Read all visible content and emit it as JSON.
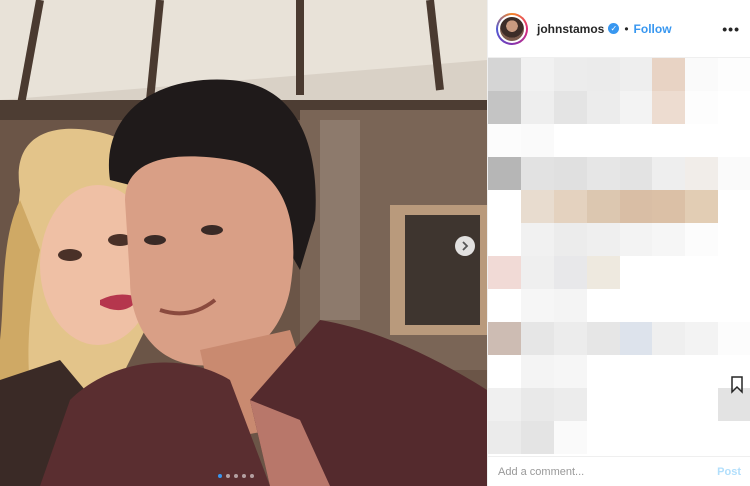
{
  "header": {
    "username": "johnstamos",
    "verified_glyph": "✓",
    "separator": "•",
    "follow_label": "Follow",
    "more_label": "•••"
  },
  "post": {
    "carousel_next_icon": "chevron-right-icon",
    "carousel_dot_count": 5,
    "carousel_active_dot": 1
  },
  "comments_area": {
    "state": "pixelated"
  },
  "footer": {
    "comment_placeholder": "Add a comment...",
    "post_label": "Post"
  },
  "colors": {
    "link_blue": "#3897f0",
    "post_disabled": "#b2dffc",
    "text": "#262626"
  }
}
